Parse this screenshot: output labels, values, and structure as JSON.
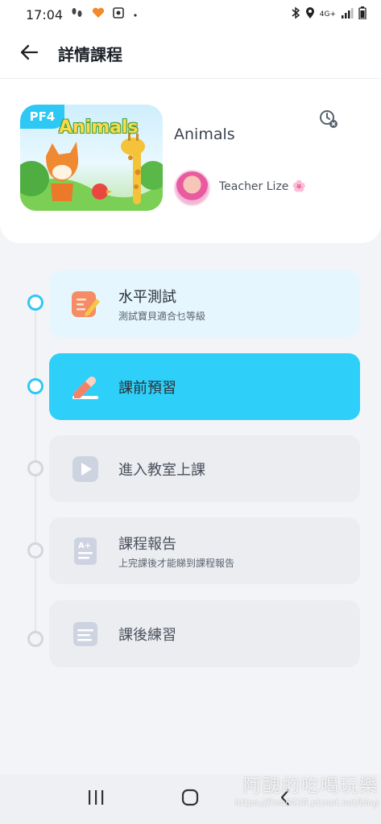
{
  "status_bar": {
    "time": "17:04",
    "network": "4G+",
    "icons": [
      "footprints-icon",
      "heart-app-icon",
      "camera-app-icon",
      "dot-icon",
      "bluetooth-icon",
      "location-icon",
      "signal-icon",
      "battery-icon"
    ]
  },
  "header": {
    "title": "詳情課程",
    "back_icon": "arrow-left-icon"
  },
  "course": {
    "badge": "PF4",
    "cover_title": "Animals",
    "name": "Animals",
    "teacher": "Teacher Lize 🌸",
    "history_icon": "clock-cancel-icon"
  },
  "steps": [
    {
      "title": "水平測試",
      "subtitle": "測試寶貝適合乜等級",
      "icon": "pencil-note-icon",
      "state": "done"
    },
    {
      "title": "課前預習",
      "subtitle": "",
      "icon": "eraser-pencil-icon",
      "state": "current"
    },
    {
      "title": "進入教室上課",
      "subtitle": "",
      "icon": "play-icon",
      "state": "locked"
    },
    {
      "title": "課程報告",
      "subtitle": "上完課後才能睇到課程報告",
      "icon": "report-a-plus-icon",
      "state": "locked"
    },
    {
      "title": "課後練習",
      "subtitle": "",
      "icon": "practice-sheet-icon",
      "state": "locked"
    }
  ],
  "colors": {
    "accent": "#2ED0FA",
    "timeline_active": "#2EC8F5",
    "locked_bg": "#EBEDF1"
  },
  "watermark": {
    "line1": "阿醜的吃喝玩樂",
    "line2": "https://fron6438.pixnet.net/blog"
  },
  "nav": {
    "icons": [
      "recent-apps-icon",
      "home-icon",
      "back-icon"
    ]
  }
}
